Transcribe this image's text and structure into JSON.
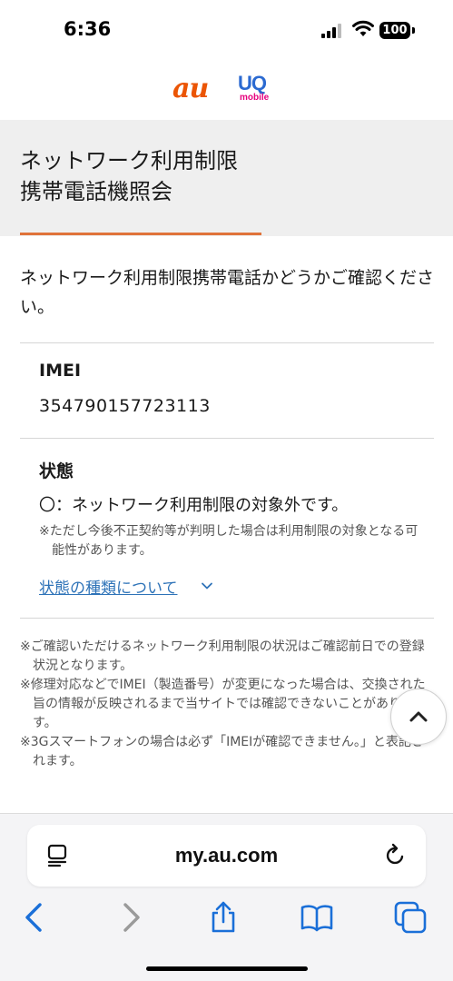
{
  "status_bar": {
    "time": "6:36",
    "battery": "100"
  },
  "logo": {
    "au": "au",
    "uq_top": "UQ",
    "uq_bottom": "mobile"
  },
  "title": {
    "line1": "ネットワーク利用制限",
    "line2": "携帯電話機照会"
  },
  "intro": "ネットワーク利用制限携帯電話かどうかご確認ください。",
  "imei": {
    "label": "IMEI",
    "value": "354790157723113"
  },
  "state": {
    "label": "状態",
    "value": "〇：ネットワーク利用制限の対象外です。",
    "note": "※ただし今後不正契約等が判明した場合は利用制限の対象となる可能性があります。",
    "link": "状態の種類について"
  },
  "notes": [
    "※ご確認いただけるネットワーク利用制限の状況はご確認前日での登録状況となります。",
    "※修理対応などでIMEI（製造番号）が変更になった場合は、交換された旨の情報が反映されるまで当サイトでは確認できないことがあります。",
    "※3Gスマートフォンの場合は必ず「IMEIが確認できません。」と表記されます。"
  ],
  "browser": {
    "url": "my.au.com"
  },
  "colors": {
    "accent": "#e0733a",
    "link": "#2e73b8",
    "ios_blue": "#1a6fd8"
  },
  "icons": {
    "reader": "reader-mode-icon",
    "reload": "reload-icon",
    "back": "back-chevron-icon",
    "forward": "forward-chevron-icon",
    "share": "share-icon",
    "bookmarks": "book-icon",
    "tabs": "tabs-icon",
    "scroll_top": "chevron-up-icon"
  }
}
